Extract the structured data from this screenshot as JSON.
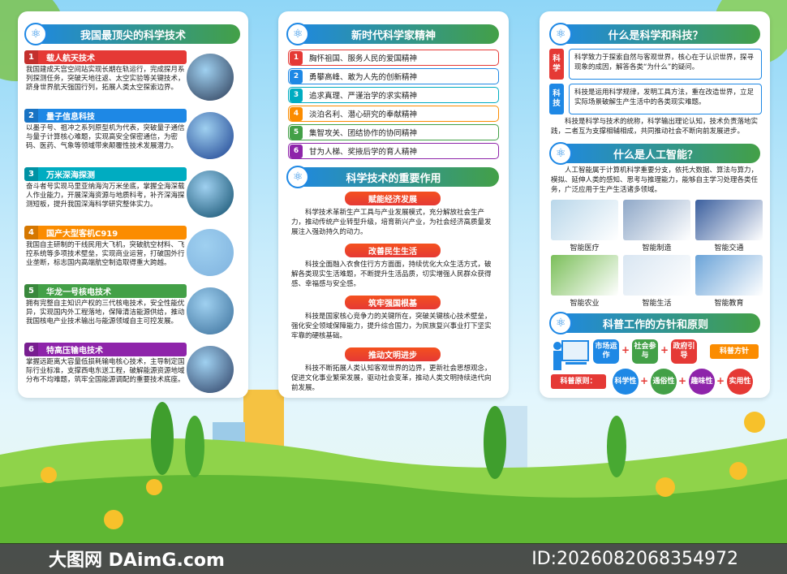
{
  "col1": {
    "header": "我国最顶尖的科学技术",
    "items": [
      {
        "num": "1",
        "title": "载人航天技术",
        "text": "我国建成天宫空间站实现长期在轨运行，完成探月系列探测任务，突破天地往返、太空实验等关键技术，跻身世界航天强国行列，拓展人类太空探索边界。",
        "color": "#e53935",
        "thumb": "#2b3a55"
      },
      {
        "num": "2",
        "title": "量子信息科技",
        "text": "以墨子号、祖冲之系列原型机为代表，突破量子通信与量子计算核心难题，实现高安全保密通信，为密码、医药、气象等领域带来颠覆性技术发展潜力。",
        "color": "#1e88e5",
        "thumb": "#1a3f8f"
      },
      {
        "num": "3",
        "title": "万米深海探测",
        "text": "奋斗者号实现马里亚纳海沟万米坐底，掌握全海深载人作业能力，开展深海资源与地质科考，补齐深海探测短板，提升我国深海科学研究整体实力。",
        "color": "#00acc1",
        "thumb": "#0f4d6b"
      },
      {
        "num": "4",
        "title": "国产大型客机C919",
        "text": "我国自主研制的干线民用大飞机，突破航空材料、飞控系统等多项技术壁垒，实现商业运营，打破国外行业垄断，标志国内高端航空制造取得重大跨越。",
        "color": "#fb8c00",
        "thumb": "#7fb2de"
      },
      {
        "num": "5",
        "title": "华龙一号核电技术",
        "text": "拥有完整自主知识产权的三代核电技术，安全性能优异，实现国内外工程落地，保障清洁能源供给，推动我国核电产业技术输出与能源领域自主可控发展。",
        "color": "#43a047",
        "thumb": "#3a6f9a"
      },
      {
        "num": "6",
        "title": "特高压输电技术",
        "text": "掌握远距离大容量低损耗输电核心技术，主导制定国际行业标准，支撑西电东送工程，破解能源资源地域分布不均难题，筑牢全国能源调配的重要技术底座。",
        "color": "#8e24aa",
        "thumb": "#2d3f63"
      }
    ]
  },
  "col2": {
    "header1": "新时代科学家精神",
    "spirits": [
      {
        "num": "1",
        "text": "胸怀祖国、服务人民的爱国精神",
        "color": "#e53935"
      },
      {
        "num": "2",
        "text": "勇攀高峰、敢为人先的创新精神",
        "color": "#1e88e5"
      },
      {
        "num": "3",
        "text": "追求真理、严谨治学的求实精神",
        "color": "#00acc1"
      },
      {
        "num": "4",
        "text": "淡泊名利、潜心研究的奉献精神",
        "color": "#fb8c00"
      },
      {
        "num": "5",
        "text": "集智攻关、团结协作的协同精神",
        "color": "#43a047"
      },
      {
        "num": "6",
        "text": "甘为人梯、奖掖后学的育人精神",
        "color": "#8e24aa"
      }
    ],
    "header2": "科学技术的重要作用",
    "roles": [
      {
        "title": "赋能经济发展",
        "text": "科学技术革新生产工具与产业发展模式，充分解放社会生产力，推动传统产业转型升级，培育新兴产业，为社会经济高质量发展注入强劲持久的动力。"
      },
      {
        "title": "改善民生生活",
        "text": "科技全面融入衣食住行方方面面，持续优化大众生活方式，破解各类现实生活难题，不断提升生活品质，切实增强人民群众获得感、幸福感与安全感。"
      },
      {
        "title": "筑牢强国根基",
        "text": "科技是国家核心竞争力的关键所在，突破关键核心技术壁垒，强化安全领域保障能力，提升综合国力，为民族复兴事业打下坚实牢靠的硬核基础。"
      },
      {
        "title": "推动文明进步",
        "text": "科技不断拓展人类认知客观世界的边界，更新社会思想观念，促进文化事业繁荣发展，驱动社会变革，推动人类文明持续迭代向前发展。"
      }
    ]
  },
  "col3": {
    "header1": "什么是科学和科技？",
    "sci_tag": "科学",
    "sci_text": "科学致力于探索自然与客观世界，核心在于认识世界，探寻现象的成因，解答各类“为什么”的疑问。",
    "tech_tag": "科技",
    "tech_text": "科技是运用科学规律，发明工具方法，重在改造世界，立足实际场景破解生产生活中的各类现实难题。",
    "summary": "科技是科学与技术的统称，科学输出理论认知，技术负责落地实践，二者互为支撑相辅相成，共同推动社会不断向前发展进步。",
    "header2": "什么是人工智能？",
    "ai_text": "人工智能属于计算机科学重要分支，依托大数据、算法与算力，模拟、延伸人类的感知、思考与推理能力，能够自主学习处理各类任务，广泛应用于生产生活诸多领域。",
    "ai_apps": [
      {
        "label": "智能医疗",
        "color": "#b9d7ea"
      },
      {
        "label": "智能制造",
        "color": "#8fa8c8"
      },
      {
        "label": "智能交通",
        "color": "#3b5f9e"
      },
      {
        "label": "智能农业",
        "color": "#7bbf5a"
      },
      {
        "label": "智能生活",
        "color": "#d9e6f2"
      },
      {
        "label": "智能教育",
        "color": "#6aa3d8"
      }
    ],
    "header3": "科普工作的方针和原则",
    "policy": [
      "市场运作",
      "社会参与",
      "政府引导"
    ],
    "policy_tag": "科普方针",
    "principle_tag": "科普原则：",
    "principles": [
      "科学性",
      "通俗性",
      "趣味性",
      "实用性"
    ]
  },
  "footer": {
    "left": "大图网 DAimG.com",
    "right": "ID:2026082068354972"
  }
}
